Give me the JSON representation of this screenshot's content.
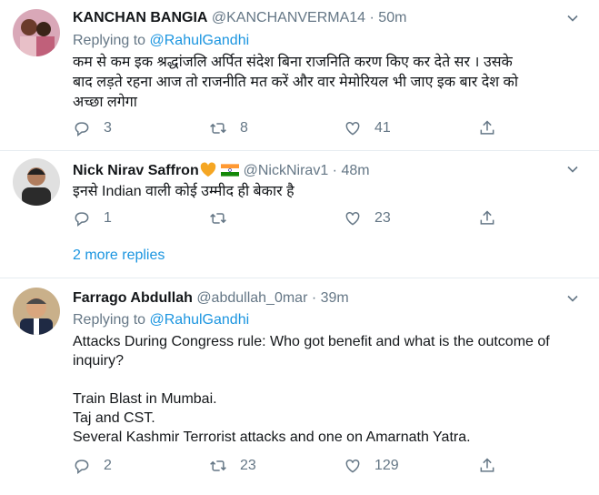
{
  "tweets": [
    {
      "name": "KANCHAN BANGIA",
      "handle": "@KANCHANVERMA14",
      "time": "· 50m",
      "replying_prefix": "Replying to ",
      "replying_to": "@RahulGandhi",
      "text": "कम से कम इक श्रद्धांजलि अर्पित संदेश बिना राजनिति करण किए कर देते सर । उसके\nबाद लड़ते रहना आज तो राजनीति मत करें और वार मेमोरियल भी जाए इक बार देश को\nअच्छा लगेगा",
      "replies": "3",
      "retweets": "8",
      "likes": "41"
    },
    {
      "name": "Nick Nirav Saffron",
      "handle": "@NickNirav1",
      "time": "· 48m",
      "text": "इनसे Indian वाली कोई उम्मीद ही बेकार है",
      "replies": "1",
      "retweets": "",
      "likes": "23"
    },
    {
      "name": "Farrago Abdullah",
      "handle": "@abdullah_0mar",
      "time": "· 39m",
      "replying_prefix": "Replying to ",
      "replying_to": "@RahulGandhi",
      "text": "Attacks During Congress rule: Who got benefit and what is the outcome of\ninquiry?\n\nTrain Blast in Mumbai.\nTaj and CST.\nSeveral Kashmir Terrorist attacks and one on Amarnath Yatra.",
      "replies": "2",
      "retweets": "23",
      "likes": "129"
    }
  ],
  "more_replies": "2 more replies",
  "icons": {
    "reply": "reply-icon",
    "retweet": "retweet-icon",
    "like": "heart-icon",
    "share": "share-icon",
    "caret": "chevron-down-icon"
  },
  "colors": {
    "link": "#1b95e0",
    "secondary": "#657786",
    "text": "#14171a",
    "divider": "#e6ecf0"
  }
}
